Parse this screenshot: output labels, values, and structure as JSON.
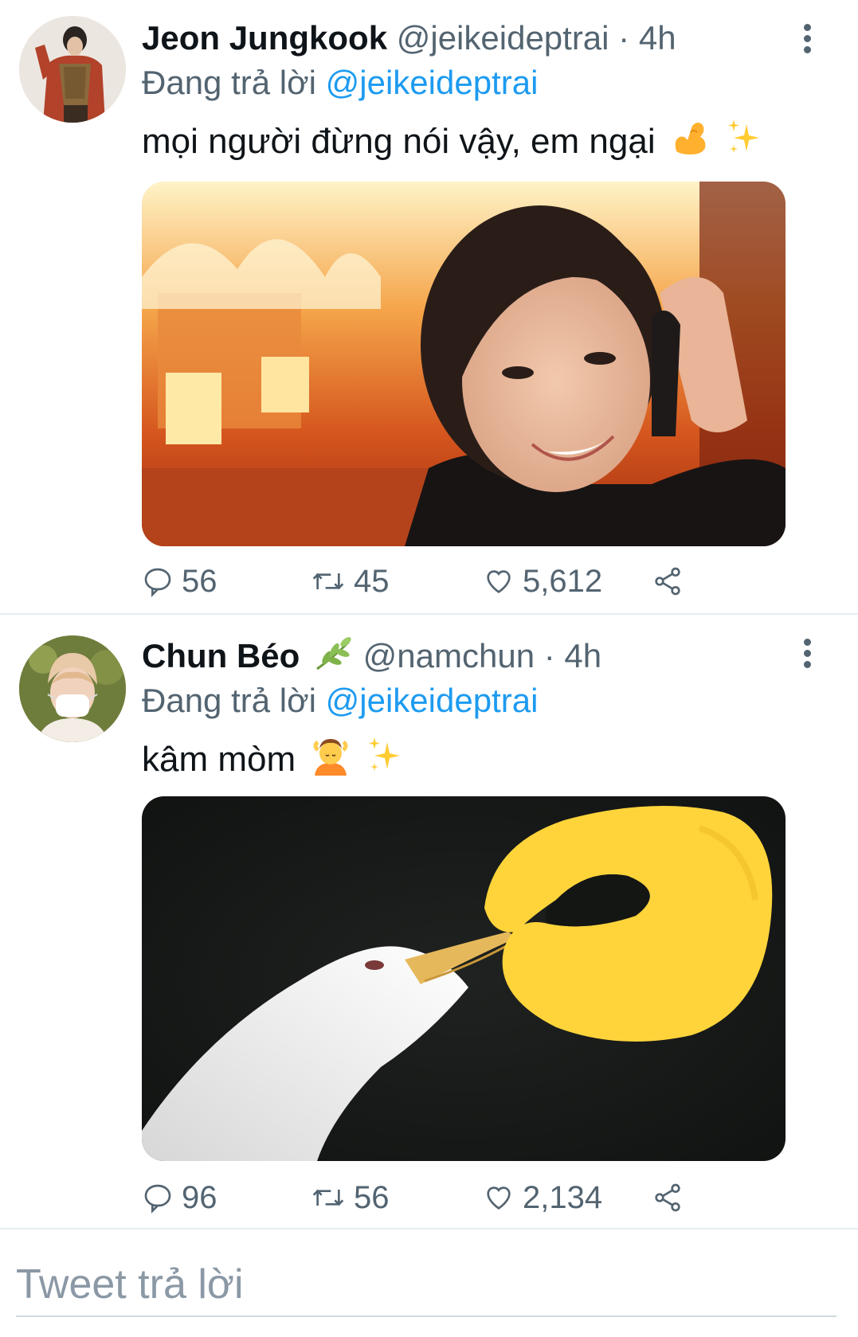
{
  "tweets": [
    {
      "name": "Jeon Jungkook",
      "handle": "@jeikeideptrai",
      "separator": "·",
      "time": "4h",
      "replying_prefix": "Đang trả lời",
      "replying_to": "@jeikeideptrai",
      "text": "mọi người đừng nói vậy, em ngại",
      "emojis": [
        "flexed-biceps-emoji",
        "sparkles-emoji"
      ],
      "media_description": "meme-photo-smiling-man-burning-house",
      "stats": {
        "replies": "56",
        "retweets": "45",
        "likes": "5,612"
      }
    },
    {
      "name": "Chun Béo",
      "name_badge": "leaf-icon",
      "handle": "@namchun",
      "separator": "·",
      "time": "4h",
      "replying_prefix": "Đang trả lời",
      "replying_to": "@jeikeideptrai",
      "text": "kâm mòm",
      "emojis": [
        "person-massage-emoji",
        "sparkles-emoji"
      ],
      "media_description": "meme-photo-hand-closing-bird-beak",
      "stats": {
        "replies": "96",
        "retweets": "56",
        "likes": "2,134"
      }
    }
  ],
  "compose": {
    "placeholder": "Tweet trả lời"
  },
  "colors": {
    "accent": "#1d9bf0",
    "muted": "#536471",
    "text": "#0f1419",
    "divider": "#e6ecf0"
  }
}
